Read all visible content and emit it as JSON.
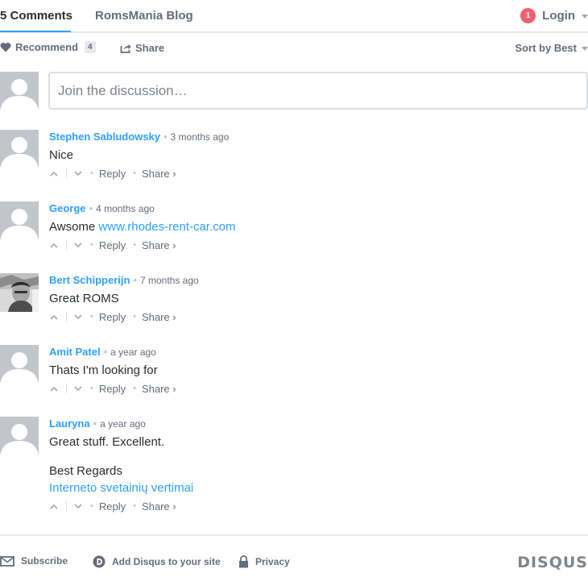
{
  "nav": {
    "comments_tab": "5 Comments",
    "blog_tab": "RomsMania Blog",
    "notification_count": "1",
    "login_label": "Login"
  },
  "toolbar": {
    "recommend_label": "Recommend",
    "recommend_count": "4",
    "share_label": "Share",
    "sort_label": "Sort by Best"
  },
  "composer": {
    "placeholder": "Join the discussion…"
  },
  "actions": {
    "reply": "Reply",
    "share": "Share ›",
    "separator": "•"
  },
  "comments": [
    {
      "author": "Stephen Sabludowsky",
      "time": "3 months ago",
      "text": "Nice"
    },
    {
      "author": "George",
      "time": "4 months ago",
      "text": "Awsome ",
      "link": "www.rhodes-rent-car.com"
    },
    {
      "author": "Bert Schipperijn",
      "time": "7 months ago",
      "text": "Great ROMS"
    },
    {
      "author": "Amit Patel",
      "time": "a year ago",
      "text": "Thats I'm looking for"
    },
    {
      "author": "Lauryna",
      "time": "a year ago",
      "text": "Great stuff. Excellent.",
      "text2": "Best Regards",
      "link": "Interneto svetainių vertimai"
    }
  ],
  "footer": {
    "subscribe": "Subscribe",
    "add_disqus": "Add Disqus to your site",
    "privacy": "Privacy",
    "logo": "DISQUS"
  },
  "colors": {
    "accent": "#2e9fff",
    "badge": "#f05f70",
    "text": "#2a2e2e",
    "muted": "#656c7a"
  }
}
